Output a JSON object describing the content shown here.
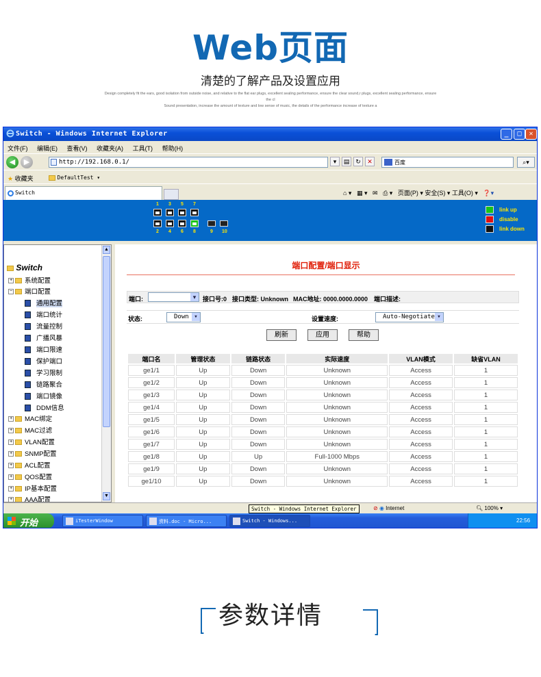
{
  "promo": {
    "title": "Web页面",
    "subtitle": "清楚的了解产品及设置应用",
    "desc_line1": "Design completely fit the ears, good isolation from outside noise, and relative to the flat ear plugs, excellent sealing performance, ensure the clear sound,r plugs, excellent sealing performance, ensure the cl",
    "desc_line2": "Sound presentation, increase the amount of texture and low sense of music, the details of the performance increase of texture a"
  },
  "window": {
    "title": "Switch - Windows Internet Explorer",
    "menu": [
      "文件(F)",
      "编辑(E)",
      "查看(V)",
      "收藏夹(A)",
      "工具(T)",
      "帮助(H)"
    ],
    "address": "http://192.168.0.1/",
    "search_placeholder": "百度",
    "favorites_label": "收藏夹",
    "favorite_item": "DefaultTest ▾",
    "tab_title": "Switch",
    "tools": "页面(P) ▾   安全(S) ▾   工具(O) ▾"
  },
  "banner": {
    "top_numbers": [
      "1",
      "3",
      "5",
      "7"
    ],
    "bottom_numbers": [
      "2",
      "4",
      "6",
      "8",
      "9",
      "10"
    ],
    "legend": [
      "link up",
      "disable",
      "link down"
    ],
    "colors": {
      "up": "#18c418",
      "disable": "#e01010",
      "down": "#111111"
    }
  },
  "tree": {
    "root": "Switch",
    "nodes_top": [
      {
        "label": "系统配置",
        "sign": "+"
      },
      {
        "label": "端口配置",
        "sign": "-"
      }
    ],
    "leaves": [
      "通用配置",
      "端口统计",
      "流量控制",
      "广播风暴",
      "端口限速",
      "保护端口",
      "学习限制",
      "链路聚合",
      "端口镜像",
      "DDM信息"
    ],
    "nodes_bottom": [
      "MAC绑定",
      "MAC过滤",
      "VLAN配置",
      "SNMP配置",
      "ACL配置",
      "QOS配置",
      "IP基本配置",
      "AAA配置"
    ]
  },
  "content": {
    "title": "端口配置/端口显示",
    "port_label": "端口:",
    "port_no": "接口号:0",
    "port_type": "接口类型: Unknown",
    "mac": "MAC地址: 0000.0000.0000",
    "port_desc": "端口描述:",
    "state_label": "状态:",
    "state_value": "Down",
    "speed_label": "设置速度:",
    "speed_value": "Auto-Negotiate",
    "buttons": [
      "刷新",
      "应用",
      "帮助"
    ],
    "columns": [
      "端口名",
      "管理状态",
      "链路状态",
      "实际速度",
      "VLAN模式",
      "缺省VLAN"
    ],
    "rows": [
      [
        "ge1/1",
        "Up",
        "Down",
        "Unknown",
        "Access",
        "1"
      ],
      [
        "ge1/2",
        "Up",
        "Down",
        "Unknown",
        "Access",
        "1"
      ],
      [
        "ge1/3",
        "Up",
        "Down",
        "Unknown",
        "Access",
        "1"
      ],
      [
        "ge1/4",
        "Up",
        "Down",
        "Unknown",
        "Access",
        "1"
      ],
      [
        "ge1/5",
        "Up",
        "Down",
        "Unknown",
        "Access",
        "1"
      ],
      [
        "ge1/6",
        "Up",
        "Down",
        "Unknown",
        "Access",
        "1"
      ],
      [
        "ge1/7",
        "Up",
        "Down",
        "Unknown",
        "Access",
        "1"
      ],
      [
        "ge1/8",
        "Up",
        "Up",
        "Full-1000 Mbps",
        "Access",
        "1"
      ],
      [
        "ge1/9",
        "Up",
        "Down",
        "Unknown",
        "Access",
        "1"
      ],
      [
        "ge1/10",
        "Up",
        "Down",
        "Unknown",
        "Access",
        "1"
      ]
    ]
  },
  "status": {
    "tooltip": "Switch - Windows Internet Explorer",
    "zone": "Internet",
    "zoom": "100%"
  },
  "taskbar": {
    "start": "开始",
    "tasks": [
      "iTesterWindow",
      "资料.doc - Micro...",
      "Switch - Windows..."
    ],
    "clock": "22:56"
  },
  "bottom": {
    "title": "参数详情"
  }
}
